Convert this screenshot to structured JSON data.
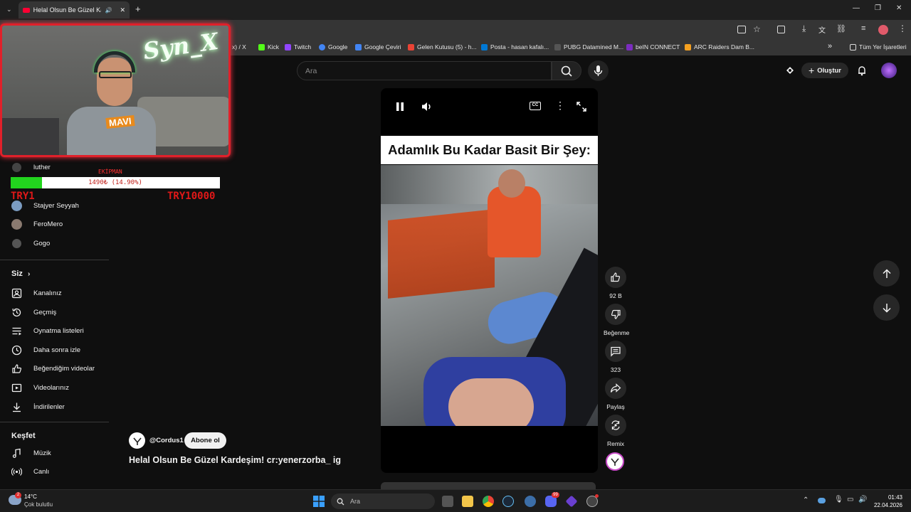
{
  "browser": {
    "tab_title": "Helal Olsun Be Güzel Karde",
    "new_tab": "+",
    "window_controls": {
      "minimize": "—",
      "restore": "❐",
      "close": "✕"
    },
    "address_partial": "x) / X",
    "bookmarks": [
      {
        "label": "Kick",
        "color": "#53fc18"
      },
      {
        "label": "Twitch",
        "color": "#9146ff"
      },
      {
        "label": "Google",
        "color": "#4285f4"
      },
      {
        "label": "Google Çeviri",
        "color": "#4285f4"
      },
      {
        "label": "Gelen Kutusu (5) - h...",
        "color": "#ea4335"
      },
      {
        "label": "Posta - hasan kafalı...",
        "color": "#0078d4"
      },
      {
        "label": "PUBG Datamined M...",
        "color": "#222222"
      },
      {
        "label": "beIN CONNECT",
        "color": "#7b2cbf"
      },
      {
        "label": "ARC Raiders Dam B...",
        "color": "#f4a020"
      }
    ],
    "bookmarks_more": "»",
    "all_bookmarks": "Tüm Yer İşaretleri"
  },
  "youtube": {
    "search_placeholder": "Ara",
    "create_label": "Oluştur",
    "sidebar": {
      "subscriptions": [
        "luther",
        "Stajyer Seyyah",
        "FeroMero",
        "Gogo"
      ],
      "you_header": "Siz",
      "you_items": [
        {
          "label": "Kanalınız",
          "icon": "channel-icon"
        },
        {
          "label": "Geçmiş",
          "icon": "history-icon"
        },
        {
          "label": "Oynatma listeleri",
          "icon": "playlist-icon"
        },
        {
          "label": "Daha sonra izle",
          "icon": "clock-icon"
        },
        {
          "label": "Beğendiğim videolar",
          "icon": "like-icon"
        },
        {
          "label": "Videolarınız",
          "icon": "video-icon"
        },
        {
          "label": "İndirilenler",
          "icon": "download-icon"
        }
      ],
      "explore_header": "Keşfet",
      "explore_items": [
        {
          "label": "Müzik",
          "icon": "music-icon"
        },
        {
          "label": "Canlı",
          "icon": "live-icon"
        }
      ]
    },
    "video": {
      "caption": "Adamlık Bu Kadar Basit Bir Şey:",
      "channel": "@Cordus1",
      "subscribe": "Abone ol",
      "title": "Helal Olsun Be Güzel Kardeşim! cr:yenerzorba_ ig"
    },
    "actions": {
      "likes": "92 B",
      "dislike": "Beğenme",
      "comments": "323",
      "share": "Paylaş",
      "remix": "Remix"
    }
  },
  "stream_overlay": {
    "webcam_text": "Syn_X",
    "shirt_text": "MAVI",
    "donation_label": "EKİPMAN",
    "donation_progress": "1490₺ (14.90%)",
    "donation_fraction": 0.149,
    "donation_min": "TRY1",
    "donation_max": "TRY10000"
  },
  "taskbar": {
    "weather_temp": "14°C",
    "weather_desc": "Çok bulutlu",
    "weather_badge": "2",
    "search_placeholder": "Ara",
    "discord_badge": "99",
    "time": "01:43",
    "date": "22.04.2026"
  }
}
